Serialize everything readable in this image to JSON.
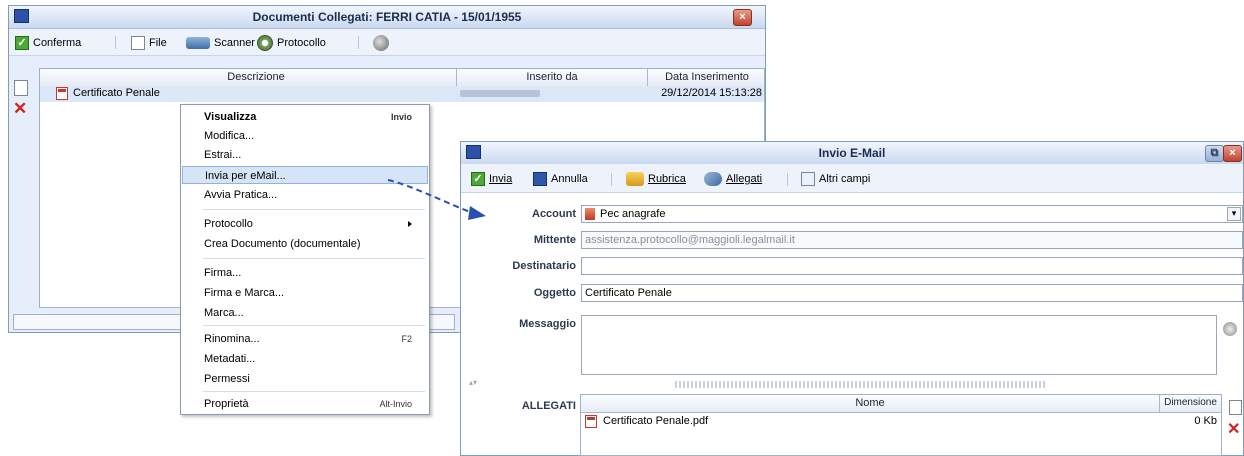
{
  "window1": {
    "title": "Documenti Collegati: FERRI CATIA - 15/01/1955",
    "close": "×",
    "toolbar": {
      "conferma": "Conferma",
      "file": "File",
      "scanner": "Scanner",
      "protocollo": "Protocollo"
    },
    "grid": {
      "columns": [
        "Descrizione",
        "Inserito da",
        "Data Inserimento"
      ],
      "rows": [
        {
          "descrizione": "Certificato Penale",
          "inserito_da": "",
          "data": "29/12/2014 15:13:28"
        }
      ]
    }
  },
  "context_menu": {
    "items": [
      {
        "label": "Visualizza",
        "shortcut": "Invio"
      },
      {
        "label": "Modifica...",
        "shortcut": ""
      },
      {
        "label": "Estrai...",
        "shortcut": ""
      },
      {
        "label": "Invia per eMail...",
        "shortcut": ""
      },
      {
        "label": "Avvia Pratica...",
        "shortcut": ""
      },
      {
        "label": "Protocollo",
        "shortcut": ""
      },
      {
        "label": "Crea Documento (documentale)",
        "shortcut": ""
      },
      {
        "label": "Firma...",
        "shortcut": ""
      },
      {
        "label": "Firma e Marca...",
        "shortcut": ""
      },
      {
        "label": "Marca...",
        "shortcut": ""
      },
      {
        "label": "Rinomina...",
        "shortcut": "F2"
      },
      {
        "label": "Metadati...",
        "shortcut": ""
      },
      {
        "label": "Permessi",
        "shortcut": ""
      },
      {
        "label": "Proprietà",
        "shortcut": "Alt-Invio"
      }
    ]
  },
  "window2": {
    "title": "Invio E-Mail",
    "close": "×",
    "toolbar": {
      "invia": "Invia",
      "annulla": "Annulla",
      "rubrica": "Rubrica",
      "allegati": "Allegati",
      "altri_campi": "Altri campi"
    },
    "form": {
      "account_label": "Account",
      "account_value": "Pec anagrafe",
      "mittente_label": "Mittente",
      "mittente_value": "assistenza.protocollo@maggioli.legalmail.it",
      "destinatario_label": "Destinatario",
      "destinatario_value": "",
      "oggetto_label": "Oggetto",
      "oggetto_value": "Certificato Penale",
      "messaggio_label": "Messaggio",
      "messaggio_value": ""
    },
    "allegati": {
      "label": "ALLEGATI",
      "columns": [
        "Nome",
        "Dimensione"
      ],
      "rows": [
        {
          "nome": "Certificato Penale.pdf",
          "dimensione": "0 Kb"
        }
      ]
    }
  },
  "colors": {
    "accent": "#2c52a8",
    "highlight": "#d6e4f7",
    "arrow": "#2a4fb0"
  }
}
